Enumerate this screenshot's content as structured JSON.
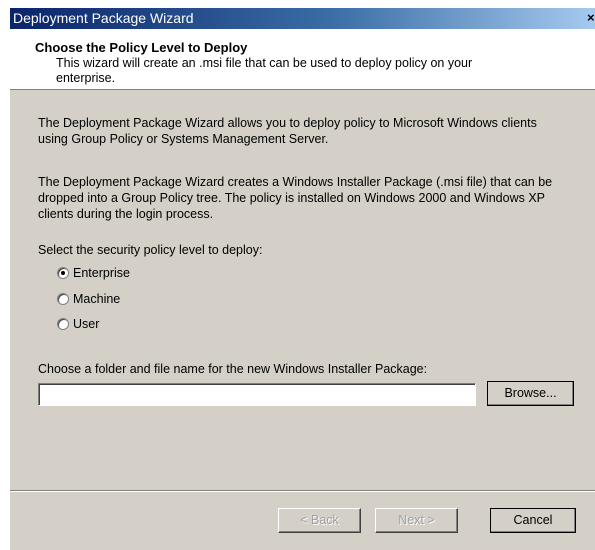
{
  "window": {
    "title": "Deployment Package Wizard",
    "close_glyph": "×"
  },
  "header": {
    "title": "Choose the Policy Level to Deploy",
    "subtitle": "This wizard will create an .msi file that can be used to deploy policy on your enterprise."
  },
  "body": {
    "paragraph1": "The Deployment Package Wizard allows you to deploy policy to Microsoft Windows clients using Group Policy or Systems Management Server.",
    "paragraph2": "The Deployment Package Wizard creates a Windows Installer Package (.msi file) that can be dropped into a Group Policy tree. The policy is installed on Windows 2000 and Windows XP clients during the login process.",
    "select_label": "Select the security policy level to deploy:",
    "options": [
      {
        "label": "Enterprise",
        "checked": true
      },
      {
        "label": "Machine",
        "checked": false
      },
      {
        "label": "User",
        "checked": false
      }
    ],
    "folder_label": "Choose a folder and file name for the new Windows Installer Package:",
    "path_value": "",
    "browse_label": "Browse..."
  },
  "footer": {
    "back_label": "< Back",
    "next_label": "Next >",
    "cancel_label": "Cancel"
  }
}
